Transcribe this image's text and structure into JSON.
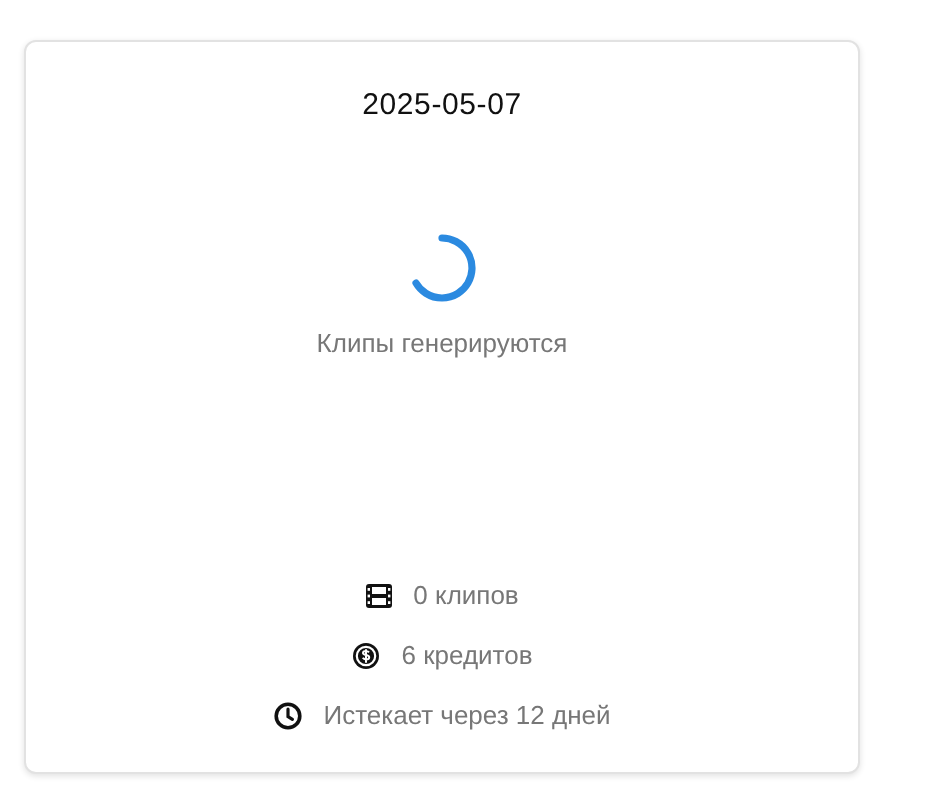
{
  "card": {
    "title": "2025-05-07",
    "status": "Клипы генерируются",
    "stats": [
      {
        "kind": "clips",
        "text": "0 клипов"
      },
      {
        "kind": "credits",
        "text": "6 кредитов"
      },
      {
        "kind": "expiry",
        "text": "Истекает через 12 дней"
      }
    ]
  }
}
